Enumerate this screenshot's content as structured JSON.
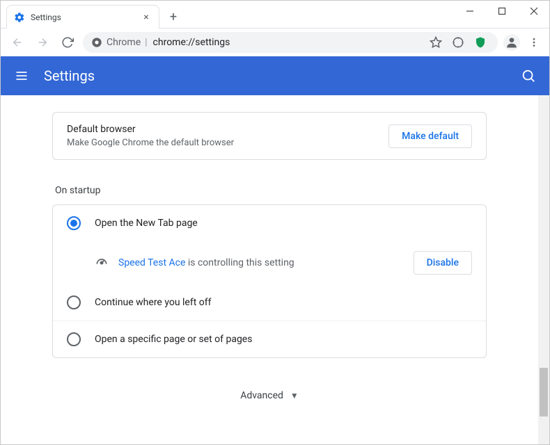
{
  "tab": {
    "title": "Settings"
  },
  "omnibox": {
    "chip": "Chrome",
    "url": "chrome://settings"
  },
  "header": {
    "title": "Settings"
  },
  "defaultBrowser": {
    "title": "Default browser",
    "subtitle": "Make Google Chrome the default browser",
    "button": "Make default"
  },
  "startup": {
    "heading": "On startup",
    "options": [
      "Open the New Tab page",
      "Continue where you left off",
      "Open a specific page or set of pages"
    ],
    "controlling": {
      "name": "Speed Test Ace",
      "suffix": " is controlling this setting"
    },
    "disable": "Disable"
  },
  "advanced": {
    "label": "Advanced"
  }
}
